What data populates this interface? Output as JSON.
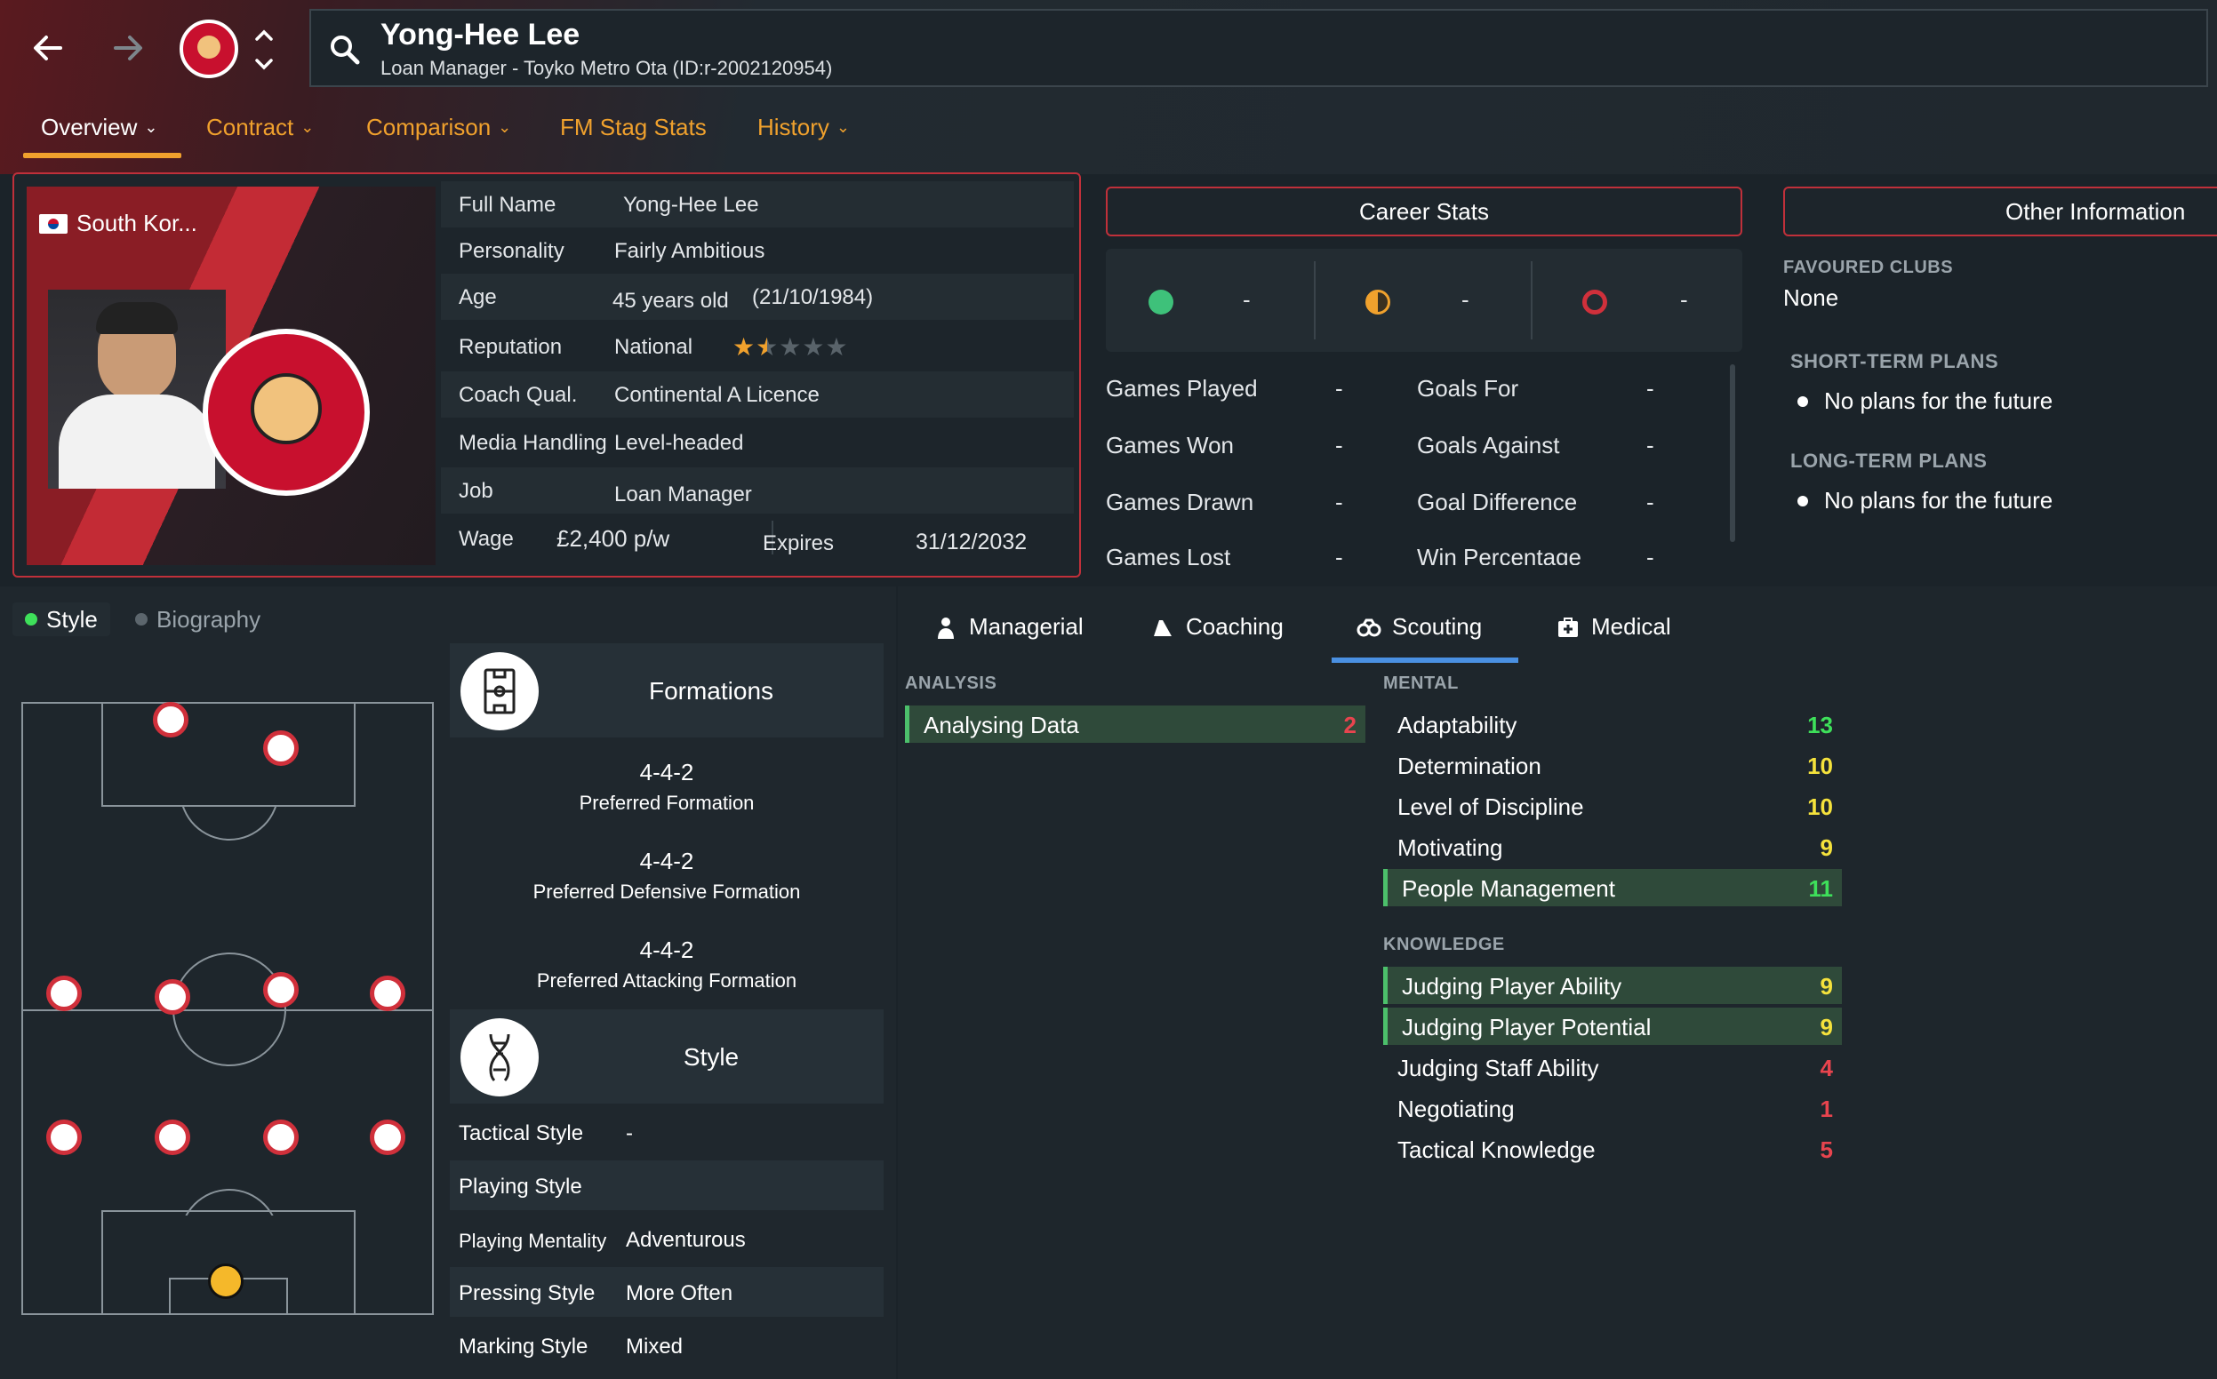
{
  "header": {
    "name": "Yong-Hee Lee",
    "subtitle": "Loan Manager - Toyko Metro Ota (ID:r-2002120954)",
    "tabs": [
      {
        "label": "Overview",
        "dropdown": true,
        "active": true
      },
      {
        "label": "Contract",
        "dropdown": true
      },
      {
        "label": "Comparison",
        "dropdown": true
      },
      {
        "label": "FM Stag Stats",
        "dropdown": false
      },
      {
        "label": "History",
        "dropdown": true
      }
    ]
  },
  "profile": {
    "nation": "South Kor...",
    "full_name_label": "Full Name",
    "full_name": "Yong-Hee Lee",
    "personality_label": "Personality",
    "personality": "Fairly Ambitious",
    "age_label": "Age",
    "age": "45 years old",
    "dob": "(21/10/1984)",
    "reputation_label": "Reputation",
    "reputation": "National",
    "reputation_stars": 1.5,
    "reputation_max": 5,
    "coach_label": "Coach Qual.",
    "coach": "Continental A Licence",
    "media_label": "Media Handling",
    "media": "Level-headed",
    "job_label": "Job",
    "job": "Loan Manager",
    "wage_label": "Wage",
    "wage": "£2,400 p/w",
    "expires_label": "Expires",
    "expires": "31/12/2032"
  },
  "career": {
    "title": "Career Stats",
    "summary": [
      "-",
      "-",
      "-"
    ],
    "rows": [
      {
        "l1": "Games Played",
        "v1": "-",
        "l2": "Goals For",
        "v2": "-"
      },
      {
        "l1": "Games Won",
        "v1": "-",
        "l2": "Goals Against",
        "v2": "-"
      },
      {
        "l1": "Games Drawn",
        "v1": "-",
        "l2": "Goal Difference",
        "v2": "-"
      },
      {
        "l1": "Games Lost",
        "v1": "-",
        "l2": "Win Percentage",
        "v2": "-"
      }
    ]
  },
  "other": {
    "title": "Other Information",
    "fav_label": "FAVOURED CLUBS",
    "fav": "None",
    "short_label": "SHORT-TERM PLANS",
    "short": "No plans for the future",
    "long_label": "LONG-TERM PLANS",
    "long": "No plans for the future"
  },
  "style_tabs": {
    "style": "Style",
    "bio": "Biography"
  },
  "formations": {
    "title": "Formations",
    "items": [
      {
        "f": "4-4-2",
        "d": "Preferred Formation"
      },
      {
        "f": "4-4-2",
        "d": "Preferred Defensive Formation"
      },
      {
        "f": "4-4-2",
        "d": "Preferred Attacking Formation"
      }
    ]
  },
  "style": {
    "title": "Style",
    "rows": [
      {
        "l": "Tactical Style",
        "v": "-"
      },
      {
        "l": "Playing Style",
        "v": ""
      },
      {
        "l": "Playing Mentality",
        "v": "Adventurous"
      },
      {
        "l": "Pressing Style",
        "v": "More Often"
      },
      {
        "l": "Marking Style",
        "v": "Mixed"
      }
    ]
  },
  "attr_tabs": [
    "Managerial",
    "Coaching",
    "Scouting",
    "Medical"
  ],
  "analysis": {
    "label": "ANALYSIS",
    "items": [
      {
        "n": "Analysing Data",
        "v": "2"
      }
    ]
  },
  "mental": {
    "label": "MENTAL",
    "items": [
      {
        "n": "Adaptability",
        "v": "13"
      },
      {
        "n": "Determination",
        "v": "10"
      },
      {
        "n": "Level of Discipline",
        "v": "10"
      },
      {
        "n": "Motivating",
        "v": "9"
      },
      {
        "n": "People Management",
        "v": "11"
      }
    ]
  },
  "knowledge": {
    "label": "KNOWLEDGE",
    "items": [
      {
        "n": "Judging Player Ability",
        "v": "9"
      },
      {
        "n": "Judging Player Potential",
        "v": "9"
      },
      {
        "n": "Judging Staff Ability",
        "v": "4"
      },
      {
        "n": "Negotiating",
        "v": "1"
      },
      {
        "n": "Tactical Knowledge",
        "v": "5"
      }
    ]
  },
  "colors": {
    "accent": "#f0a12d",
    "border_red": "#c0303a",
    "good": "#3ee05a",
    "mid": "#f5e23c",
    "bad": "#e8444e"
  }
}
